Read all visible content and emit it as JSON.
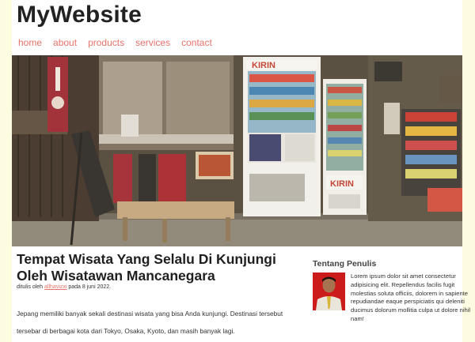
{
  "site": {
    "title": "MyWebsite"
  },
  "nav": {
    "items": [
      "home",
      "about",
      "products",
      "services",
      "contact"
    ]
  },
  "hero": {
    "sign_brand": "KIRIN",
    "sign_brand_lower": "KIRIN"
  },
  "post": {
    "title": "Tempat Wisata Yang Selalu Di Kunjungi Oleh Wisatawan Mancanegara",
    "meta_prefix": "ditulis oleh ",
    "author": "allhavizxi",
    "meta_suffix": " pada 8 juni 2022.",
    "body": "Jepang memiliki banyak sekali destinasi wisata yang bisa Anda kunjungi. Destinasi tersebut tersebar di berbagai kota dari Tokyo, Osaka, Kyoto, dan masih banyak lagi."
  },
  "sidebar": {
    "title": "Tentang Penulis",
    "bio": "Lorem ipsum dolor sit amet consectetur adipisicing elit. Repellendus facilis fugit molestias soluta officiis, dolorem in sapiente repudiandae eaque perspiciatis qui deleniti ducimus dolorum mollitia culpa ut dolore nihil nam!"
  },
  "colors": {
    "background": "#fdfbe0",
    "link": "#e8736b",
    "photo_bg": "#cc1b1b"
  }
}
